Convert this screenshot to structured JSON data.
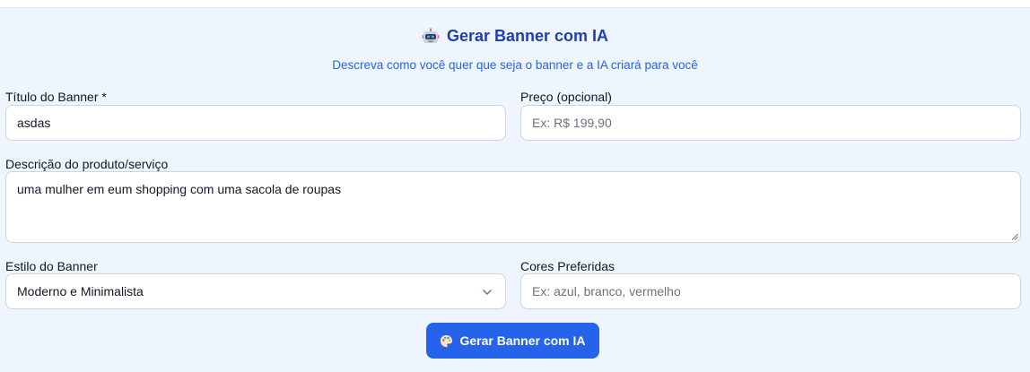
{
  "header": {
    "title": "Gerar Banner com IA",
    "subtitle": "Descreva como você quer que seja o banner e a IA criará para você",
    "icon": "robot-icon"
  },
  "form": {
    "title_field": {
      "label": "Título do Banner *",
      "value": "asdas"
    },
    "price_field": {
      "label": "Preço (opcional)",
      "value": "",
      "placeholder": "Ex: R$ 199,90"
    },
    "description_field": {
      "label": "Descrição do produto/serviço",
      "value": "uma mulher em eum shopping com uma sacola de roupas"
    },
    "style_field": {
      "label": "Estilo do Banner",
      "selected": "Moderno e Minimalista"
    },
    "colors_field": {
      "label": "Cores Preferidas",
      "value": "",
      "placeholder": "Ex: azul, branco, vermelho"
    }
  },
  "submit": {
    "label": "Gerar Banner com IA",
    "icon": "palette-icon"
  },
  "colors": {
    "accent": "#2563eb",
    "title": "#1e40af",
    "panel_bg": "#eff5ff"
  }
}
